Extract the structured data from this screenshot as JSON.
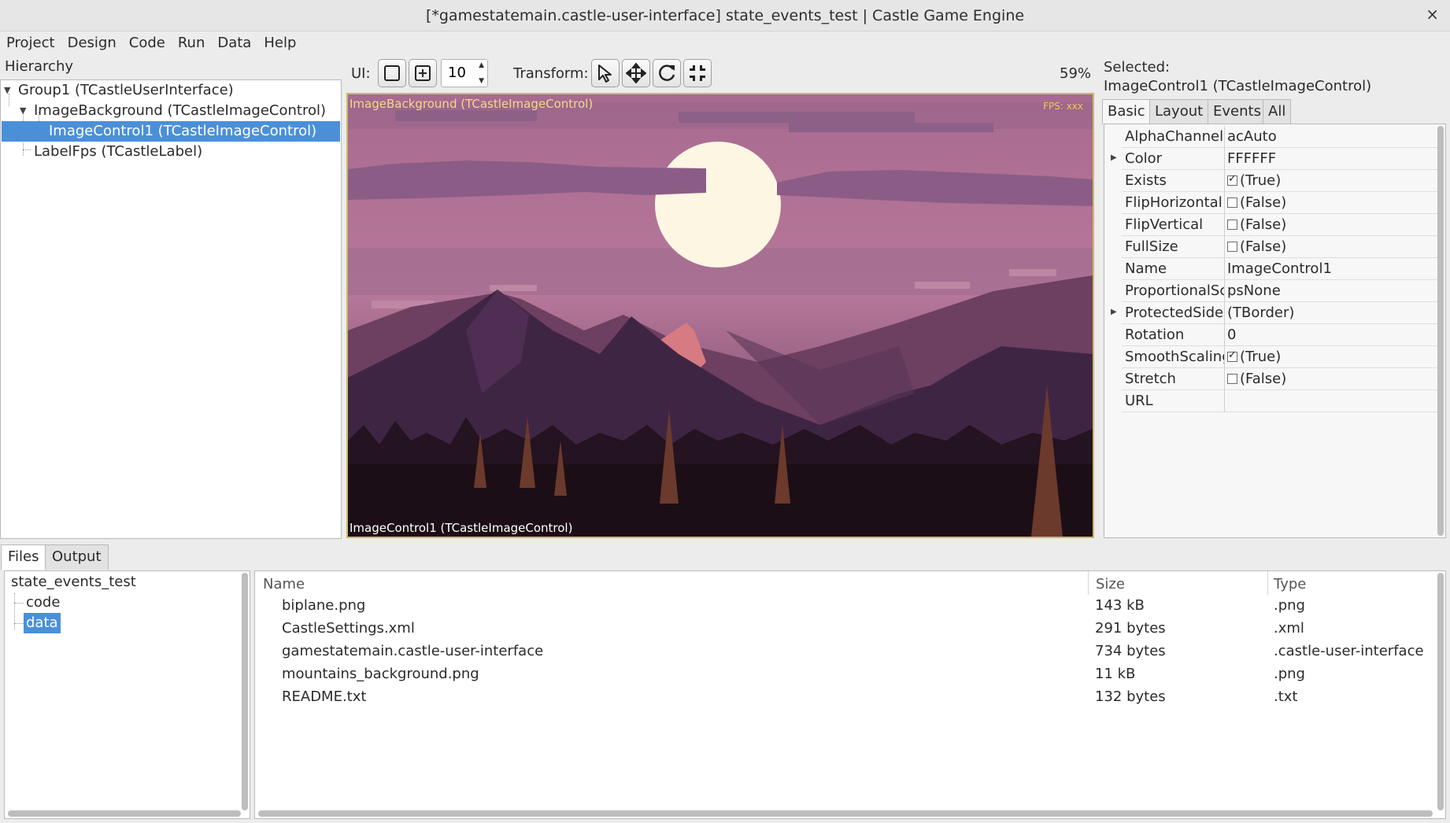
{
  "window": {
    "title": "[*gamestatemain.castle-user-interface] state_events_test | Castle Game Engine",
    "close_glyph": "×"
  },
  "menu": [
    "Project",
    "Design",
    "Code",
    "Run",
    "Data",
    "Help"
  ],
  "hierarchy": {
    "label": "Hierarchy",
    "items": [
      "Group1 (TCastleUserInterface)",
      "ImageBackground (TCastleImageControl)",
      "ImageControl1 (TCastleImageControl)",
      "LabelFps (TCastleLabel)"
    ]
  },
  "toolbar": {
    "ui_label": "UI:",
    "spin_value": "10",
    "transform_label": "Transform:",
    "zoom": "59%"
  },
  "viewport": {
    "label_top": "ImageBackground (TCastleImageControl)",
    "fps": "FPS: xxx",
    "label_bottom": "ImageControl1 (TCastleImageControl)"
  },
  "inspector": {
    "selected_label": "Selected:",
    "selected_name": "ImageControl1 (TCastleImageControl)",
    "tabs": [
      "Basic",
      "Layout",
      "Events",
      "All"
    ],
    "properties": [
      {
        "name": "AlphaChannel",
        "value": "acAuto"
      },
      {
        "name": "Color",
        "value": "FFFFFF"
      },
      {
        "name": "Exists",
        "value": "(True)"
      },
      {
        "name": "FlipHorizontal",
        "value": "(False)"
      },
      {
        "name": "FlipVertical",
        "value": "(False)"
      },
      {
        "name": "FullSize",
        "value": "(False)"
      },
      {
        "name": "Name",
        "value": "ImageControl1"
      },
      {
        "name": "ProportionalScaling",
        "value": "psNone"
      },
      {
        "name": "ProtectedSides",
        "value": "(TBorder)"
      },
      {
        "name": "Rotation",
        "value": "0"
      },
      {
        "name": "SmoothScaling",
        "value": "(True)"
      },
      {
        "name": "Stretch",
        "value": "(False)"
      },
      {
        "name": "URL",
        "value": ""
      }
    ]
  },
  "bottom": {
    "tabs": [
      "Files",
      "Output"
    ],
    "tree": [
      "state_events_test",
      "code",
      "data"
    ],
    "columns": [
      "Name",
      "Size",
      "Type"
    ],
    "files": [
      {
        "name": "biplane.png",
        "size": "143 kB",
        "type": ".png"
      },
      {
        "name": "CastleSettings.xml",
        "size": "291 bytes",
        "type": ".xml"
      },
      {
        "name": "gamestatemain.castle-user-interface",
        "size": "734 bytes",
        "type": ".castle-user-interface"
      },
      {
        "name": "mountains_background.png",
        "size": "11 kB",
        "type": ".png"
      },
      {
        "name": "README.txt",
        "size": "132 bytes",
        "type": ".txt"
      }
    ]
  },
  "colors": {
    "selection": "#4a90d9",
    "viewport_border": "#c9b96a",
    "label_top": "#f3d98c",
    "fps": "#f3c64d"
  }
}
